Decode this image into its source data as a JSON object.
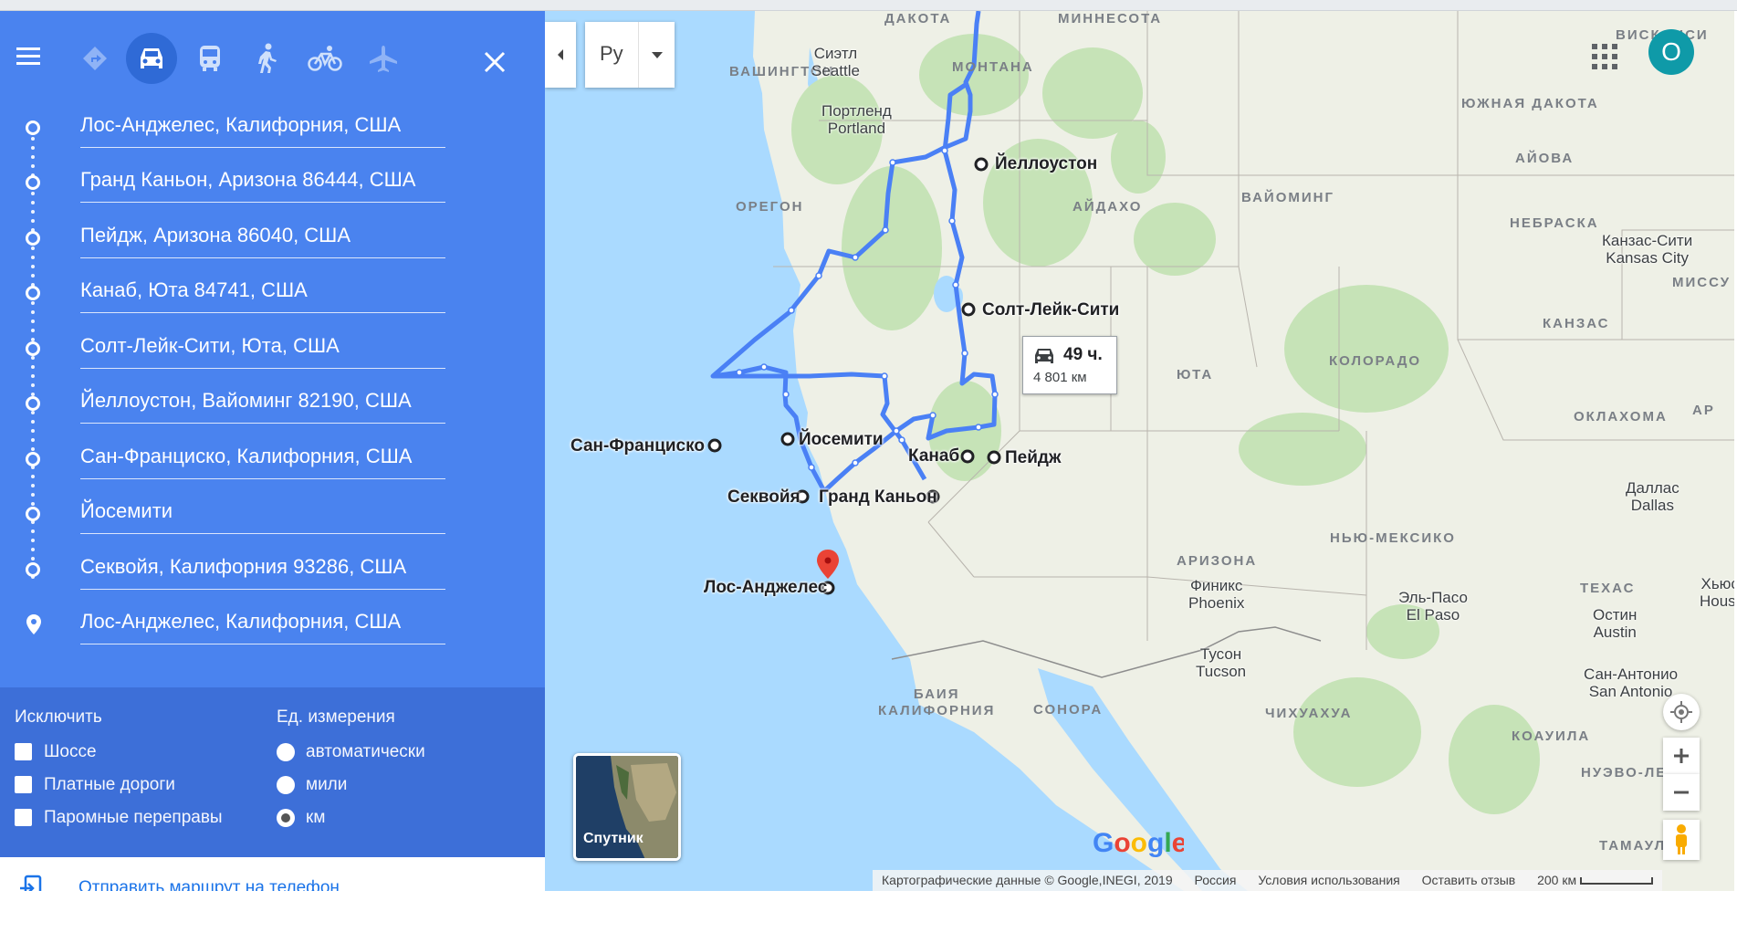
{
  "travel_modes": [
    {
      "name": "best-route-icon",
      "active": false
    },
    {
      "name": "car-icon",
      "active": true
    },
    {
      "name": "transit-icon",
      "active": false
    },
    {
      "name": "walk-icon",
      "active": false
    },
    {
      "name": "bike-icon",
      "active": false
    },
    {
      "name": "flight-icon",
      "active": false
    }
  ],
  "stops": [
    "Лос-Анджелес, Калифорния, США",
    "Гранд Каньон, Аризона 86444, США",
    "Пейдж, Аризона 86040, США",
    "Канаб, Юта 84741, США",
    "Солт-Лейк-Сити, Юта, США",
    "Йеллоустон, Вайоминг 82190, США",
    "Сан-Франциско, Калифорния, США",
    "Йосемити",
    "Секвойя, Калифорния 93286, США",
    "Лос-Анджелес, Калифорния, США"
  ],
  "options": {
    "avoid_title": "Исключить",
    "avoid": [
      "Шоссе",
      "Платные дороги",
      "Паромные переправы"
    ],
    "units_title": "Ед. измерения",
    "units": [
      "автоматически",
      "мили",
      "км"
    ],
    "units_selected": "км"
  },
  "send_to_phone": "Отправить маршрут на телефон",
  "map": {
    "language": "Ру",
    "account_initial": "O",
    "route_duration": "49 ч.",
    "route_distance": "4 801 км",
    "satellite_label": "Спутник",
    "google_logo": "Google",
    "places": {
      "yellowstone": "Йеллоустон",
      "salt_lake": "Солт-Лейк-Сити",
      "san_francisco": "Сан-Франциско",
      "yosemite": "Йосемити",
      "kanab": "Канаб",
      "page": "Пейдж",
      "sequoia": "Секвойя",
      "grand_canyon": "Гранд Каньон",
      "los_angeles": "Лос-Анджелес"
    },
    "regions": {
      "washington": "ВАШИНГТОН",
      "montana": "МОНТАНА",
      "south_dakota": "ЮЖНАЯ\nДАКОТА",
      "dakota": "ДАКОТА",
      "minnesota": "МИННЕСОТА",
      "wisconsin": "ВИСКОНСИ",
      "oregon": "ОРЕГОН",
      "idaho": "АЙДАХО",
      "wyoming": "ВАЙОМИНГ",
      "iowa": "АЙОВА",
      "nebraska": "НЕБРАСКА",
      "missouri": "МИССУ",
      "kansas": "КАНЗАС",
      "colorado": "КОЛОРАДО",
      "utah": "ЮТА",
      "oklahoma": "ОКЛАХОМА",
      "arkansas": "АР",
      "arizona": "АРИЗОНА",
      "new_mexico": "НЬЮ-МЕКСИКО",
      "texas": "ТЕХАС",
      "baja": "БАИЯ\nКАЛИФОРНИЯ",
      "sonora": "СОНОРА",
      "chihuahua": "ЧИХУАХУА",
      "coahuila": "КОАУИЛА",
      "nuevo_leon": "НУЭВО-ЛЕОН",
      "tamaulipas": "ТАМАУЛ"
    },
    "towns": {
      "seattle": "Сиэтл\nSeattle",
      "portland": "Портленд\nPortland",
      "kansas_city": "Канзас-Сити\nKansas City",
      "dallas": "Даллас\nDallas",
      "phoenix": "Финикс\nPhoenix",
      "el_paso": "Эль-Пасо\nEl Paso",
      "tucson": "Тусон\nTucson",
      "austin": "Остин\nAustin",
      "houston": "Хьюс\nHoust",
      "san_antonio": "Сан-Антонио\nSan Antonio"
    },
    "footer": {
      "copyright": "Картографические данные © Google,INEGI, 2019",
      "country": "Россия",
      "terms": "Условия использования",
      "feedback": "Оставить отзыв",
      "scale": "200 км"
    }
  },
  "colors": {
    "panel_blue": "#4a83ef",
    "options_blue": "#3d6fd8",
    "route_blue": "#4a80f5",
    "water": "#aadaff",
    "land": "#eef0e6",
    "park": "#c6e3b7",
    "pin_red": "#ea4335",
    "account_teal": "#0f9aa8"
  }
}
